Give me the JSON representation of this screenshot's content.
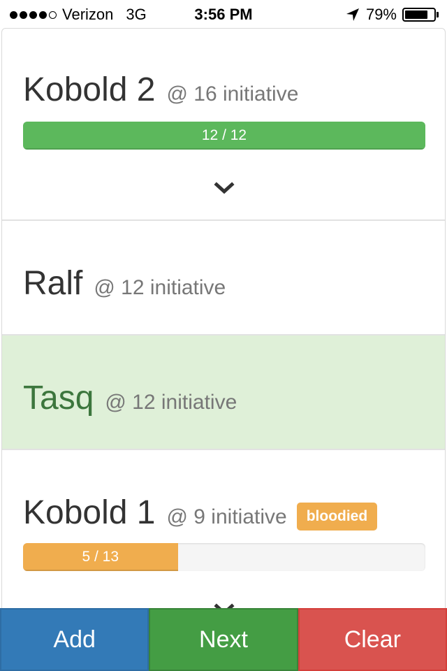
{
  "status_bar": {
    "carrier": "Verizon",
    "network": "3G",
    "time": "3:56 PM",
    "battery_percent": "79%",
    "battery_level": 0.79,
    "signal_bars_filled": 4,
    "signal_bars_total": 5,
    "icons": [
      "signal-dots",
      "location-arrow",
      "battery"
    ]
  },
  "combatants": [
    {
      "name": "Kobold 2",
      "initiative": "@ 16 initiative",
      "hp_label": "12 / 12",
      "hp_current": 12,
      "hp_max": 12,
      "hp_color": "#5cb85c",
      "active": false
    },
    {
      "name": "Ralf",
      "initiative": "@ 12 initiative",
      "active": false
    },
    {
      "name": "Tasq",
      "initiative": "@ 12 initiative",
      "active": true
    },
    {
      "name": "Kobold 1",
      "initiative": "@ 9 initiative",
      "badge": "bloodied",
      "hp_label": "5 / 13",
      "hp_current": 5,
      "hp_max": 13,
      "hp_color": "#f0ad4e",
      "active": false
    }
  ],
  "colors": {
    "active_row": "#dff0d8",
    "active_text": "#3c763d",
    "badge_warning": "#f0ad4e",
    "add": "#337ab7",
    "next": "#449d44",
    "clear": "#d9534f"
  },
  "buttons": {
    "add": "Add",
    "next": "Next",
    "clear": "Clear"
  }
}
